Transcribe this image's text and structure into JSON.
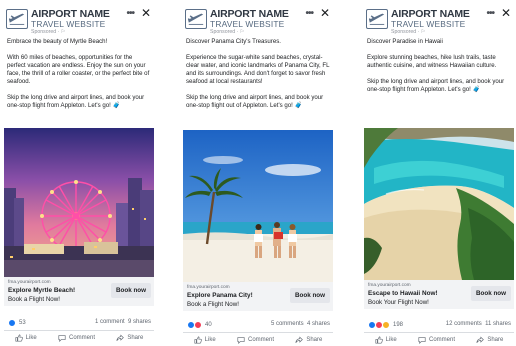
{
  "ads": [
    {
      "brand_line1": "AIRPORT NAME",
      "brand_line2": "TRAVEL WEBSITE",
      "sponsored": "Sponsored · ⚐",
      "more": "•••",
      "close": "✕",
      "p1": "Embrace the beauty of Myrtle Beach!",
      "p2": "With 60 miles of beaches, opportunities for the perfect vacation are endless. Enjoy the sun on your face, the thrill of a roller coaster, or the perfect bite of seafood.",
      "p3": "Skip the long drive and airport lines, and book your one-stop flight from Appleton. Let's go! 🧳",
      "domain": "fma.yourairport.com",
      "link_title": "Explore Myrtle Beach!",
      "link_desc": "Book a Flight Now!",
      "cta": "Book now",
      "reaction_count": "53",
      "comments": "1 comment",
      "shares": "9 shares",
      "like_label": "Like",
      "comment_label": "Comment",
      "share_label": "Share"
    },
    {
      "brand_line1": "AIRPORT NAME",
      "brand_line2": "TRAVEL WEBSITE",
      "sponsored": "Sponsored · ⚐",
      "more": "•••",
      "close": "✕",
      "p1": "Discover Panama City's Treasures.",
      "p2": "Experience the sugar-white sand beaches, crystal-clear water, and iconic landmarks of Panama City, FL and its surroundings. And don't forget to savor fresh seafood at local restaurants!",
      "p3": "Skip the long drive and airport lines, and book your one-stop flight out of Appleton. Let's go! 🧳",
      "domain": "fma.yourairport.com",
      "link_title": "Explore Panama City!",
      "link_desc": "Book a Flight Now!",
      "cta": "Book now",
      "reaction_count": "40",
      "comments": "5 comments",
      "shares": "4 shares",
      "like_label": "Like",
      "comment_label": "Comment",
      "share_label": "Share"
    },
    {
      "brand_line1": "AIRPORT NAME",
      "brand_line2": "TRAVEL WEBSITE",
      "sponsored": "Sponsored · ⚐",
      "more": "•••",
      "close": "✕",
      "p1": "Discover Paradise in Hawaii",
      "p2": "Explore stunning beaches, hike lush trails, taste authentic cuisine, and witness Hawaiian culture.",
      "p3": "Skip the long drive and airport lines, and book your one-stop flight from Appleton. Let's go! 🧳",
      "domain": "fma.yourairport.com",
      "link_title": "Escape to Hawaii Now!",
      "link_desc": "Book Your Flight Now!",
      "cta": "Book now",
      "reaction_count": "198",
      "comments": "12 comments",
      "shares": "11 shares",
      "like_label": "Like",
      "comment_label": "Comment",
      "share_label": "Share"
    }
  ],
  "icons": {
    "logo": "airplane-logo-icon",
    "more": "more-options-icon",
    "close": "close-icon",
    "like": "thumbs-up-icon",
    "comment": "speech-bubble-icon",
    "share": "share-arrow-icon"
  },
  "colors": {
    "link_bar": "#f2f3f5",
    "button": "#e4e6eb",
    "like_reaction": "#1877f2",
    "love_reaction": "#f33e58",
    "wow_reaction": "#f7b125",
    "brand_text": "#2f3742"
  }
}
